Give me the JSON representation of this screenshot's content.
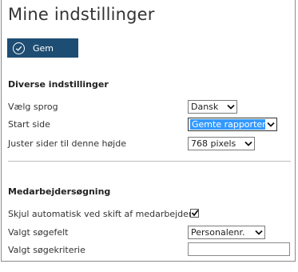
{
  "page": {
    "title": "Mine indstillinger"
  },
  "toolbar": {
    "save_label": "Gem"
  },
  "diverse": {
    "heading": "Diverse indstillinger",
    "language_label": "Vælg sprog",
    "language_value": "Dansk",
    "start_page_label": "Start side",
    "start_page_value": "Gemte rapporter",
    "height_label": "Juster sider til denne højde",
    "height_value": "768 pixels"
  },
  "search": {
    "heading": "Medarbejdersøgning",
    "auto_hide_label": "Skjul automatisk ved skift af medarbejder",
    "auto_hide_checked": true,
    "field_label": "Valgt søgefelt",
    "field_value": "Personalenr.",
    "criteria_label": "Valgt søgekriterie",
    "criteria_value": ""
  },
  "colors": {
    "button_bg": "#1e4d73",
    "selection": "#3399ff"
  }
}
